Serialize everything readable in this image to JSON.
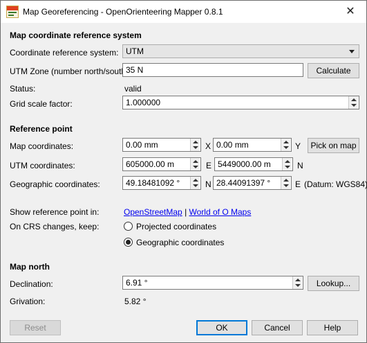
{
  "window": {
    "title": "Map Georeferencing - OpenOrienteering Mapper 0.8.1",
    "close_glyph": "✕"
  },
  "crs": {
    "heading": "Map coordinate reference system",
    "crs_label": "Coordinate reference system:",
    "crs_value": "UTM",
    "zone_label": "UTM Zone (number north/south):",
    "zone_value": "35 N",
    "calculate_label": "Calculate",
    "status_label": "Status:",
    "status_value": "valid",
    "grid_label": "Grid scale factor:",
    "grid_value": "1.000000"
  },
  "refpoint": {
    "heading": "Reference point",
    "map_label": "Map coordinates:",
    "map_x": "0.00 mm",
    "map_x_axis": "X",
    "map_y": "0.00 mm",
    "map_y_axis": "Y",
    "pick_label": "Pick on map",
    "utm_label": "UTM coordinates:",
    "utm_e": "605000.00 m",
    "utm_e_axis": "E",
    "utm_n": "5449000.00 m",
    "utm_n_axis": "N",
    "geo_label": "Geographic coordinates:",
    "geo_lat": "49.18481092 °",
    "geo_lat_axis": "N",
    "geo_lon": "28.44091397 °",
    "geo_lon_axis": "E",
    "datum": "(Datum: WGS84)",
    "show_label": "Show reference point in:",
    "link_osm": "OpenStreetMap",
    "link_sep": "|",
    "link_wom": "World of O Maps",
    "keep_label": "On CRS changes, keep:",
    "radio_projected": "Projected coordinates",
    "radio_geographic": "Geographic coordinates"
  },
  "north": {
    "heading": "Map north",
    "declination_label": "Declination:",
    "declination_value": "6.91 °",
    "lookup_label": "Lookup...",
    "grivation_label": "Grivation:",
    "grivation_value": "5.82 °"
  },
  "footer": {
    "reset_label": "Reset",
    "ok_label": "OK",
    "cancel_label": "Cancel",
    "help_label": "Help"
  }
}
